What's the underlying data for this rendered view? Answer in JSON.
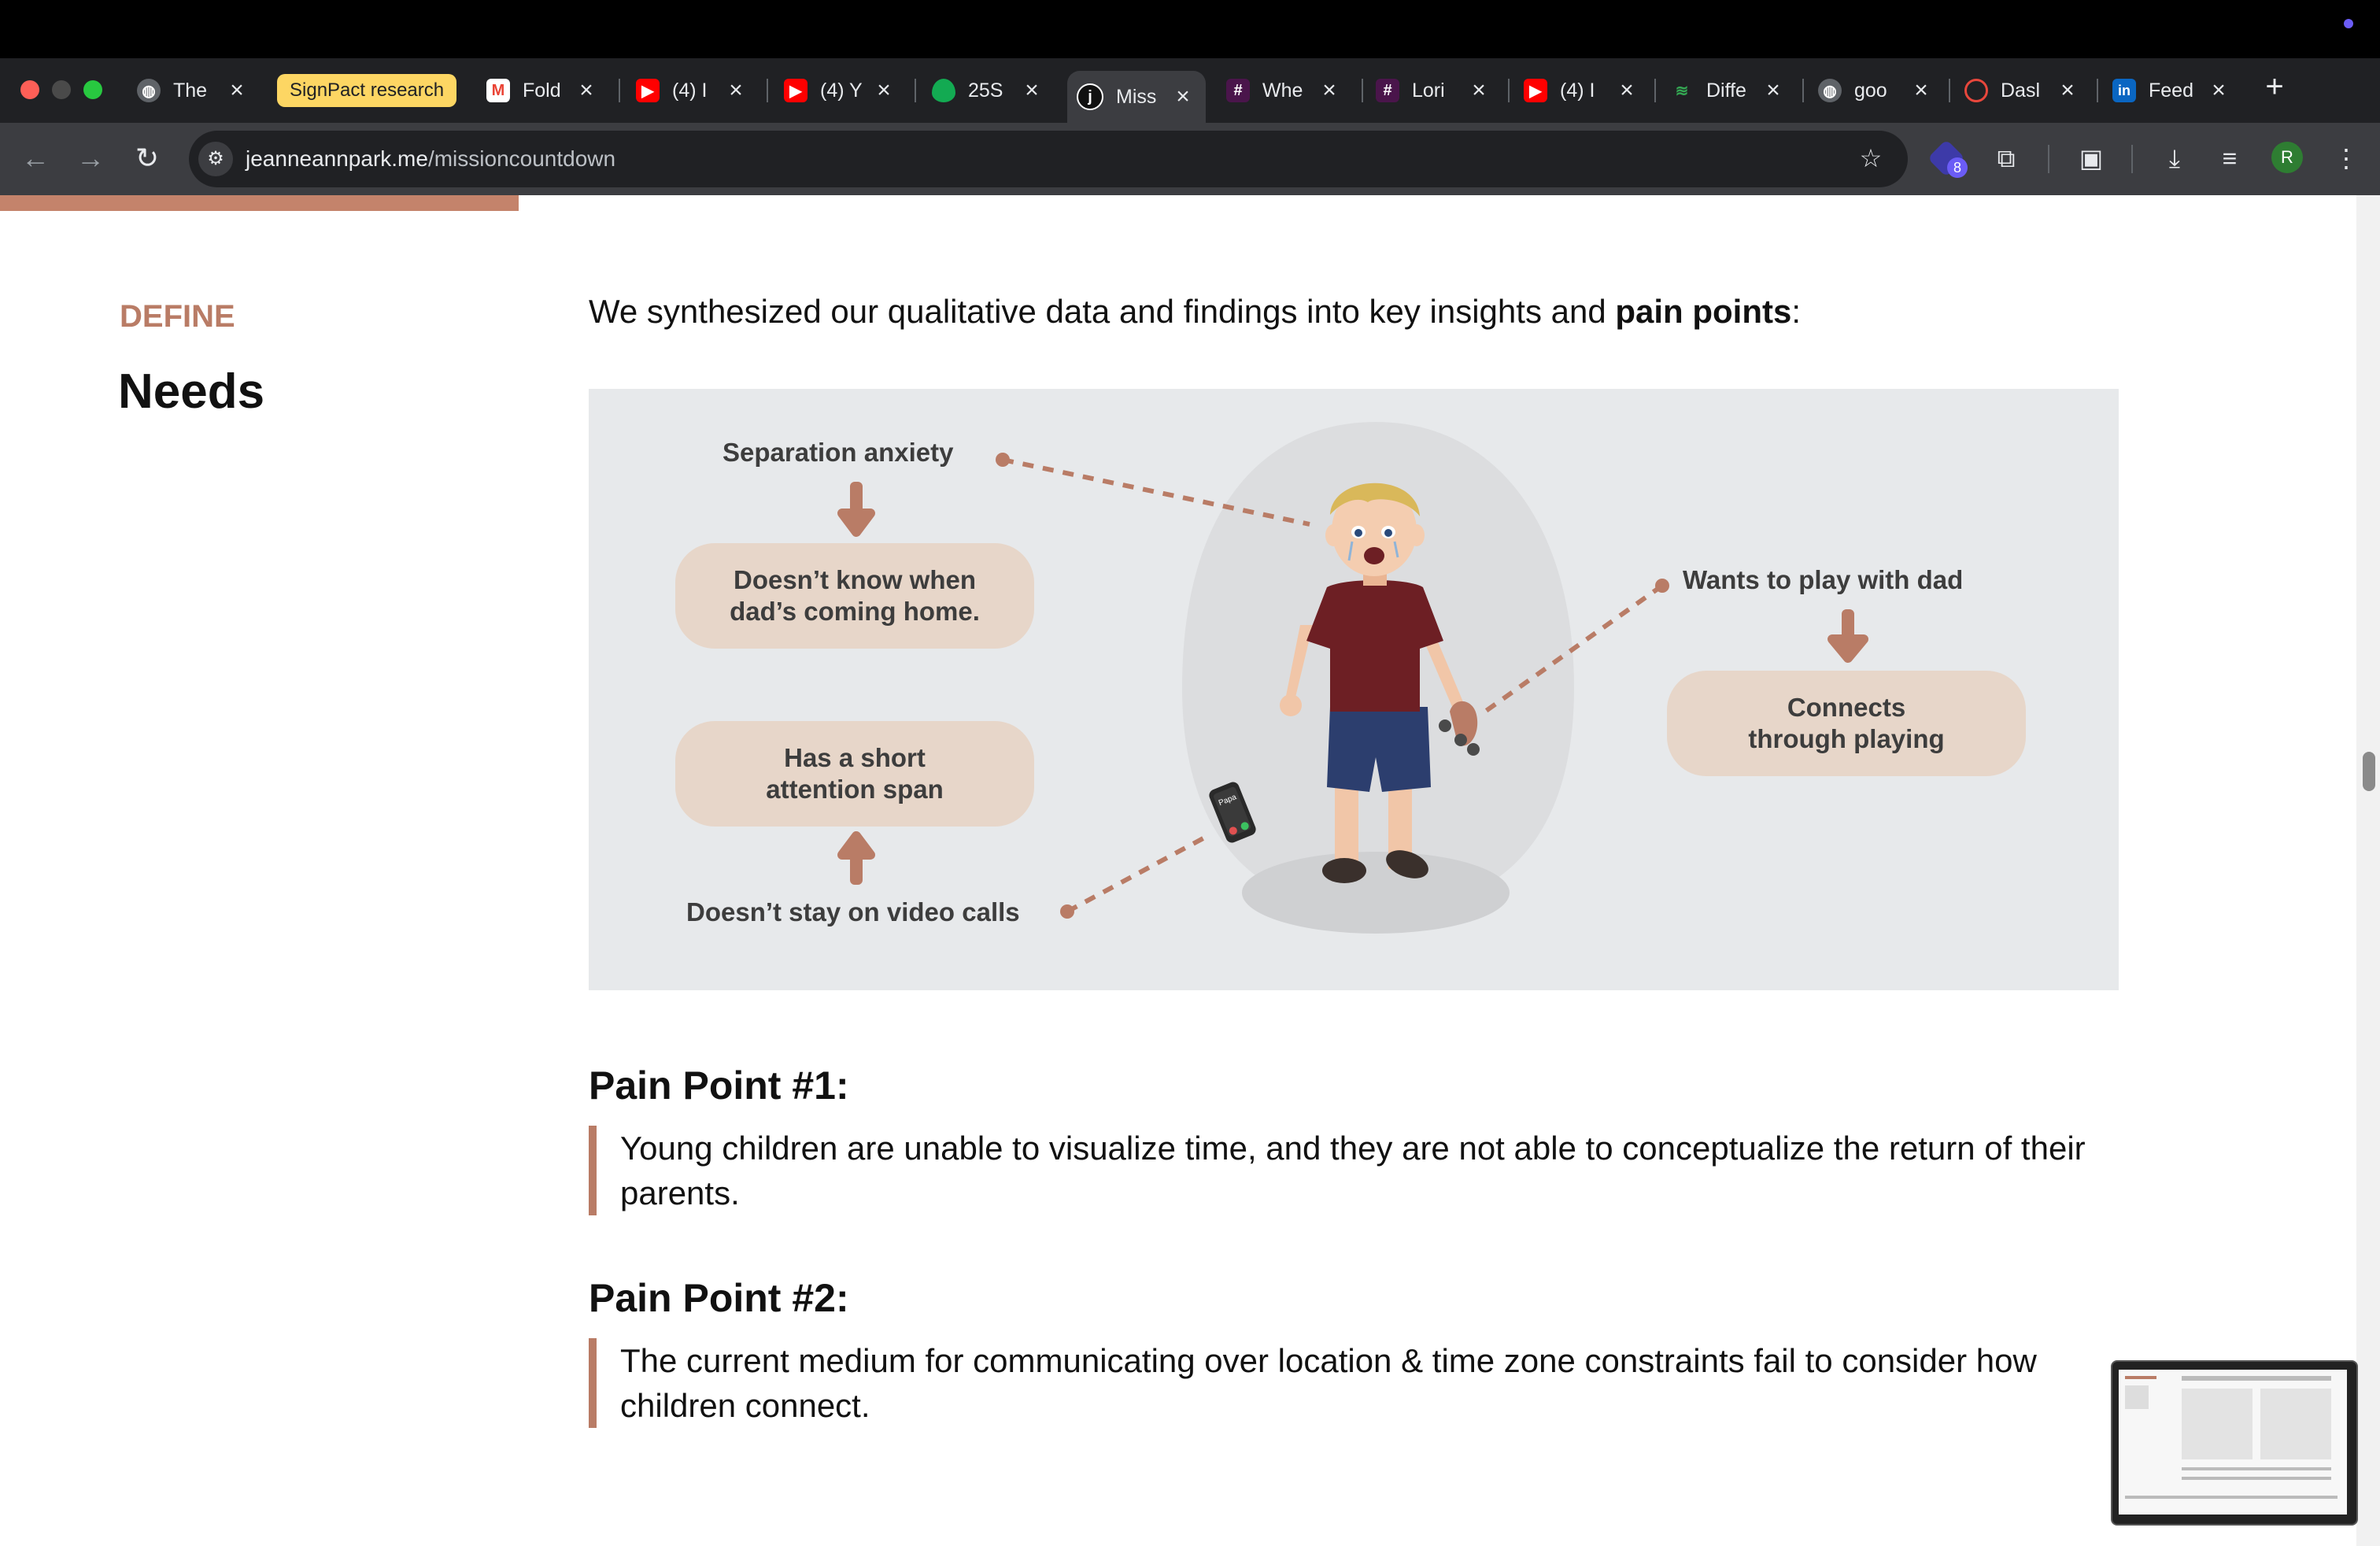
{
  "browser": {
    "tabs": [
      {
        "title": "The",
        "icon": "globe-icon",
        "color": "#5f6368"
      },
      {
        "title": "Fold",
        "icon": "gmail-icon",
        "color": "#ea4335"
      },
      {
        "title": "(4) I",
        "icon": "youtube-icon",
        "color": "#ff0000"
      },
      {
        "title": "(4) Y",
        "icon": "youtube-icon",
        "color": "#ff0000"
      },
      {
        "title": "25S",
        "icon": "mongodb-icon",
        "color": "#13aa52"
      },
      {
        "title": "Miss",
        "icon": "jeanneann-icon",
        "color": "#111111",
        "active": true
      },
      {
        "title": "Whe",
        "icon": "slack-icon",
        "color": "#e01e5a"
      },
      {
        "title": "Lori",
        "icon": "slack-icon",
        "color": "#e01e5a"
      },
      {
        "title": "(4) I",
        "icon": "youtube-icon",
        "color": "#ff0000"
      },
      {
        "title": "Diffe",
        "icon": "diff-icon",
        "color": "#34a853"
      },
      {
        "title": "goo",
        "icon": "globe-icon",
        "color": "#5f6368"
      },
      {
        "title": "Dasl",
        "icon": "dashboard-icon",
        "color": "#e8473c"
      },
      {
        "title": "Feed",
        "icon": "linkedin-icon",
        "color": "#0a66c2"
      }
    ],
    "group_label": "SignPact research",
    "url_host": "jeanneannpark.me",
    "url_path": "/missioncountdown",
    "extension_badge": "8",
    "profile_initial": "R"
  },
  "page": {
    "section_kicker": "DEFINE",
    "section_title": "Needs",
    "intro_text": "We synthesized our qualitative data and findings into key insights and ",
    "intro_bold": "pain points",
    "intro_end": ":",
    "illustration": {
      "separation_anxiety": "Separation anxiety",
      "doesnt_know_line1": "Doesn’t know when",
      "doesnt_know_line2": "dad’s coming home.",
      "short_attention_line1": "Has a short",
      "short_attention_line2": "attention span",
      "video_calls": "Doesn’t stay on video calls",
      "wants_play": "Wants to play with dad",
      "connects_line1": "Connects",
      "connects_line2": "through playing",
      "phone_label": "Papa"
    },
    "pain_points": [
      {
        "heading": "Pain Point #1:",
        "text": "Young children are unable to visualize time, and they are not able to conceptualize the return of their parents."
      },
      {
        "heading": "Pain Point #2:",
        "text": "The current medium for communicating over location & time zone constraints fail to consider how children connect."
      }
    ],
    "reading_progress": 0.22
  },
  "colors": {
    "accent": "#b97c66",
    "pill_bg": "#e7d6c9",
    "illustration_bg": "#e7e9eb"
  }
}
